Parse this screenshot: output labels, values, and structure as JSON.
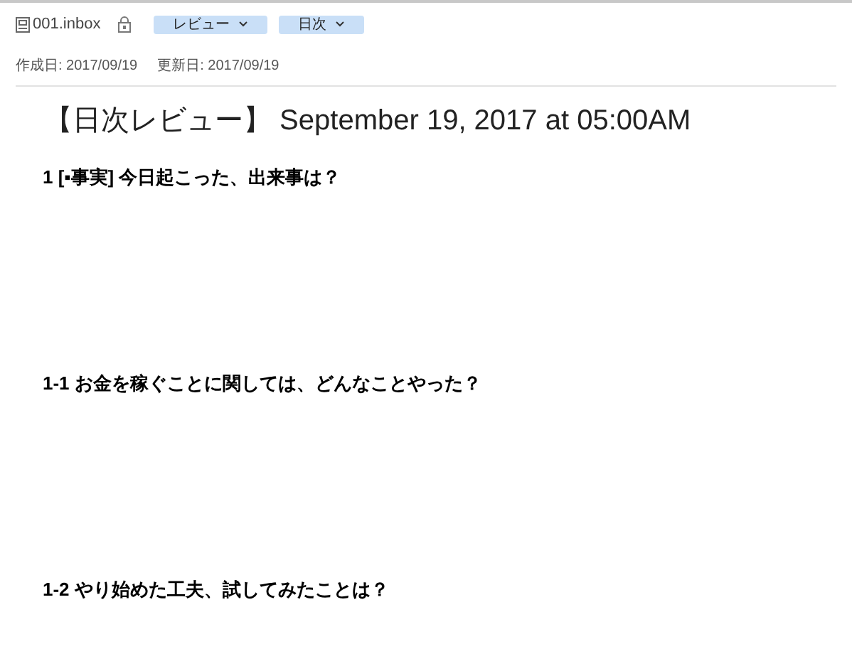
{
  "note": {
    "notebook": "001.inbox",
    "tags": [
      {
        "label": "レビュー"
      },
      {
        "label": "日次"
      }
    ]
  },
  "meta": [
    {
      "text": "作成日: 2017/09/19"
    },
    {
      "text": "更新日: 2017/09/19"
    }
  ],
  "title": "【日次レビュー】 September 19, 2017 at 05:00AM",
  "headings": [
    {
      "text": "1 [▪事実] 今日起こった、出来事は？"
    },
    {
      "text": "1-1 お金を稼ぐことに関しては、どんなことやった？"
    },
    {
      "text": "1-2 やり始めた工夫、試してみたことは？"
    }
  ]
}
